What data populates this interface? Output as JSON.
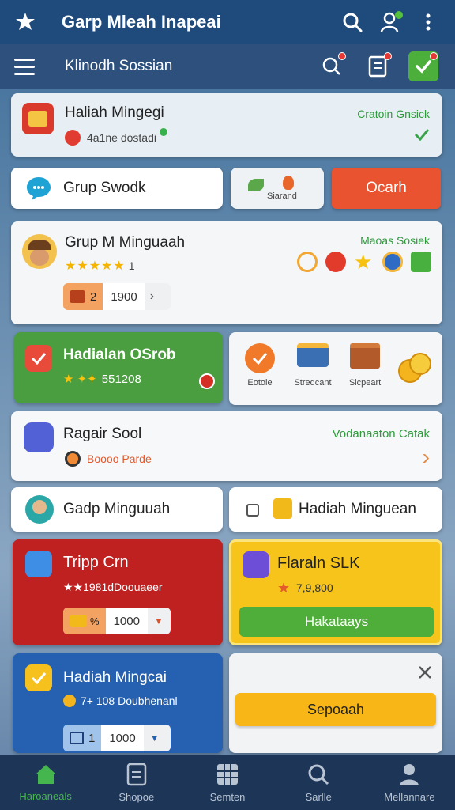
{
  "header": {
    "title": "Garp Mleah Inapeai"
  },
  "nav": {
    "subtitle": "Klinodh Sossian"
  },
  "card1": {
    "title": "Haliah Mingegi",
    "subtitle": "4a1ne dostadi",
    "right_text": "Cratoin Gnsick"
  },
  "row2": {
    "chip_label": "Grup Swodk",
    "middle_label": "Siarand",
    "button_label": "Ocarh"
  },
  "card3": {
    "title": "Grup M Minguaah",
    "rating": "★★★★★",
    "rating_count": "1",
    "pill_count": "2",
    "pill_value": "1900",
    "right_label": "Maoas Sosiek"
  },
  "card4": {
    "title": "Hadialan OSrob",
    "stars": "★ ✦✦",
    "value": "551208",
    "items": [
      {
        "label": "Eotole"
      },
      {
        "label": "Stredcant"
      },
      {
        "label": "Sicpeart"
      }
    ]
  },
  "card5": {
    "title": "Ragair Sool",
    "subtitle": "Boooo Parde",
    "right_label": "Vodanaaton Catak"
  },
  "row6": {
    "left_label": "Gadp Minguuah",
    "right_label": "Hadiah Minguean"
  },
  "card7": {
    "title": "Tripp Crn",
    "subtitle": "★★1981dDoouaeer",
    "pill_value": "1000"
  },
  "card8": {
    "title": "Flaraln SLK",
    "subtitle": "7,9,800",
    "button_label": "Hakataays"
  },
  "card9": {
    "title": "Hadiah Mingcai",
    "subtitle": "7+ 108 Doubhenanl",
    "pill_count": "1",
    "pill_value": "1000"
  },
  "card10": {
    "button_label": "Sepoaah"
  },
  "bottom_nav": {
    "items": [
      {
        "label": "Haroaneals"
      },
      {
        "label": "Shopoe"
      },
      {
        "label": "Semten"
      },
      {
        "label": "Sarlle"
      },
      {
        "label": "Mellannare"
      }
    ]
  }
}
